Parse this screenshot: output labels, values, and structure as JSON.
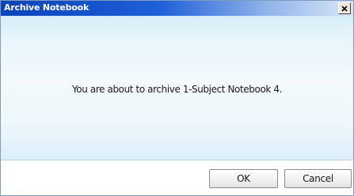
{
  "dialog": {
    "title": "Archive Notebook",
    "close_icon": "close-icon",
    "message": "You are about to archive 1-Subject Notebook 4.",
    "buttons": {
      "ok_label": "OK",
      "cancel_label": "Cancel"
    }
  },
  "colors": {
    "titlebar_start": "#0b43b8",
    "titlebar_end": "#d9e6f8",
    "body_background": "#e9f6fc",
    "title_text": "#ffffff"
  }
}
